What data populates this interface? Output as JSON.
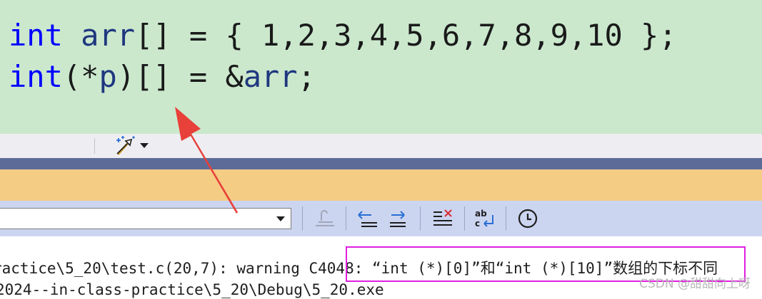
{
  "editor": {
    "line1": {
      "kw": "int",
      "var": "arr",
      "rest": "[] = { 1,2,3,4,5,6,7,8,9,10 };"
    },
    "line2": {
      "kw": "int",
      "open": "(*",
      "var": "p",
      "mid": ")[] = &",
      "var2": "arr",
      "end": ";"
    }
  },
  "toolbar": {
    "wand_icon": "magic-wand-icon",
    "dropdown_icon": "chevron-down-icon"
  },
  "output_toolbar": {
    "icons": [
      "find-message-icon",
      "go-to-previous-icon",
      "go-to-next-icon",
      "clear-all-icon",
      "word-wrap-icon",
      "clock-icon"
    ]
  },
  "output": {
    "line1": "ractice\\5_20\\test.c(20,7): warning C4048: “int (*)[0]”和“int (*)[10]”数组的下标不同",
    "line2": "2024--in-class-practice\\5_20\\Debug\\5_20.exe"
  },
  "watermark": "CSDN @甜甜向上呀",
  "colors": {
    "editor_bg": "#cbe8cd",
    "keyword": "#0000ff",
    "variable": "#1f377f",
    "annotation_arrow": "#e8413a",
    "highlight_box": "#e020e0"
  }
}
